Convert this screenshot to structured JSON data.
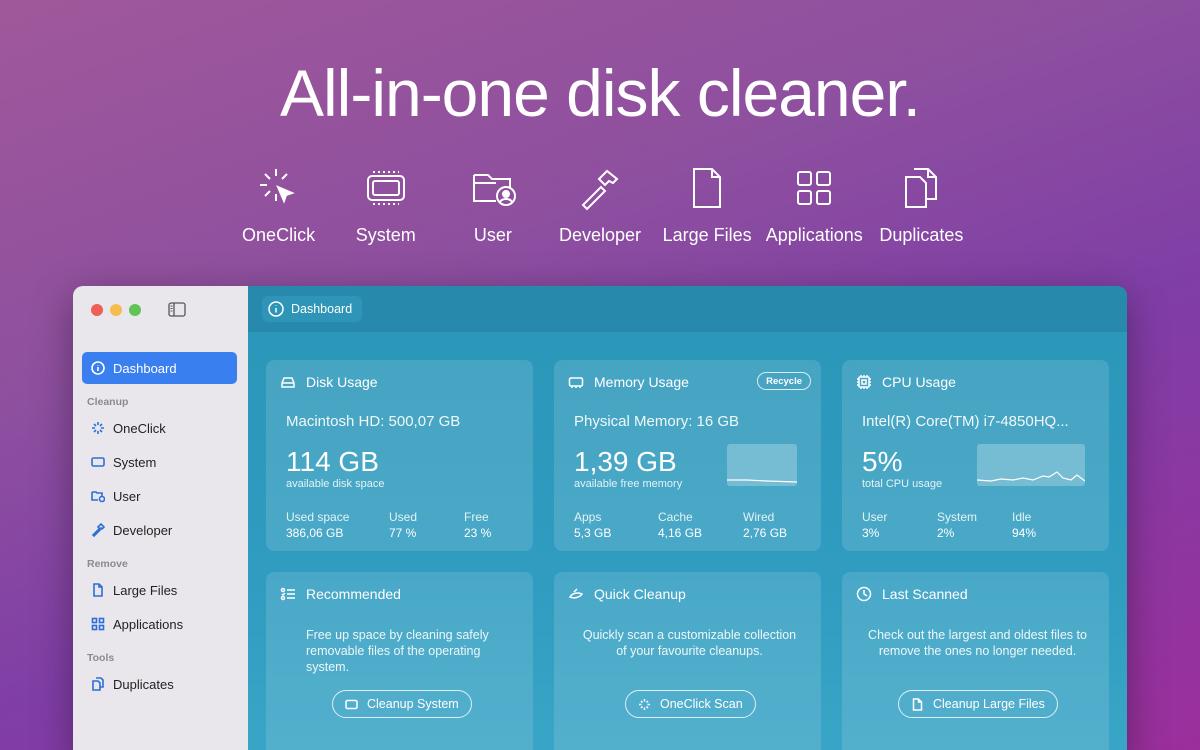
{
  "hero": {
    "title": "All-in-one disk cleaner.",
    "features": [
      {
        "label": "OneClick",
        "icon": "oneclick-icon"
      },
      {
        "label": "System",
        "icon": "system-icon"
      },
      {
        "label": "User",
        "icon": "user-folder-icon"
      },
      {
        "label": "Developer",
        "icon": "hammer-icon"
      },
      {
        "label": "Large Files",
        "icon": "file-icon"
      },
      {
        "label": "Applications",
        "icon": "grid-icon"
      },
      {
        "label": "Duplicates",
        "icon": "duplicates-icon"
      }
    ]
  },
  "sidebar": {
    "dashboard": "Dashboard",
    "sections": {
      "cleanup": "Cleanup",
      "remove": "Remove",
      "tools": "Tools"
    },
    "items": {
      "oneclick": "OneClick",
      "system": "System",
      "user": "User",
      "developer": "Developer",
      "large_files": "Large Files",
      "applications": "Applications",
      "duplicates": "Duplicates"
    }
  },
  "topbar": {
    "breadcrumb": "Dashboard"
  },
  "cards": {
    "disk": {
      "title": "Disk Usage",
      "subtitle": "Macintosh HD: 500,07 GB",
      "value": "114 GB",
      "note": "available disk space",
      "stats": [
        {
          "label": "Used space",
          "value": "386,06 GB"
        },
        {
          "label": "Used",
          "value": "77 %"
        },
        {
          "label": "Free",
          "value": "23 %"
        }
      ]
    },
    "memory": {
      "title": "Memory Usage",
      "badge": "Recycle",
      "subtitle": "Physical Memory: 16 GB",
      "value": "1,39 GB",
      "note": "available free memory",
      "stats": [
        {
          "label": "Apps",
          "value": "5,3 GB"
        },
        {
          "label": "Cache",
          "value": "4,16 GB"
        },
        {
          "label": "Wired",
          "value": "2,76 GB"
        }
      ]
    },
    "cpu": {
      "title": "CPU Usage",
      "subtitle": "Intel(R) Core(TM) i7-4850HQ...",
      "value": "5%",
      "note": "total CPU usage",
      "stats": [
        {
          "label": "User",
          "value": "3%"
        },
        {
          "label": "System",
          "value": "2%"
        },
        {
          "label": "Idle",
          "value": "94%"
        }
      ]
    },
    "recommended": {
      "title": "Recommended",
      "text": "Free up space by cleaning safely removable files of the operating system.",
      "button": "Cleanup System"
    },
    "quick": {
      "title": "Quick Cleanup",
      "text": "Quickly scan a customizable collection of your favourite cleanups.",
      "button": "OneClick Scan"
    },
    "last": {
      "title": "Last Scanned",
      "text": "Check out the largest and oldest files to remove the ones no longer needed.",
      "button": "Cleanup Large Files"
    }
  }
}
